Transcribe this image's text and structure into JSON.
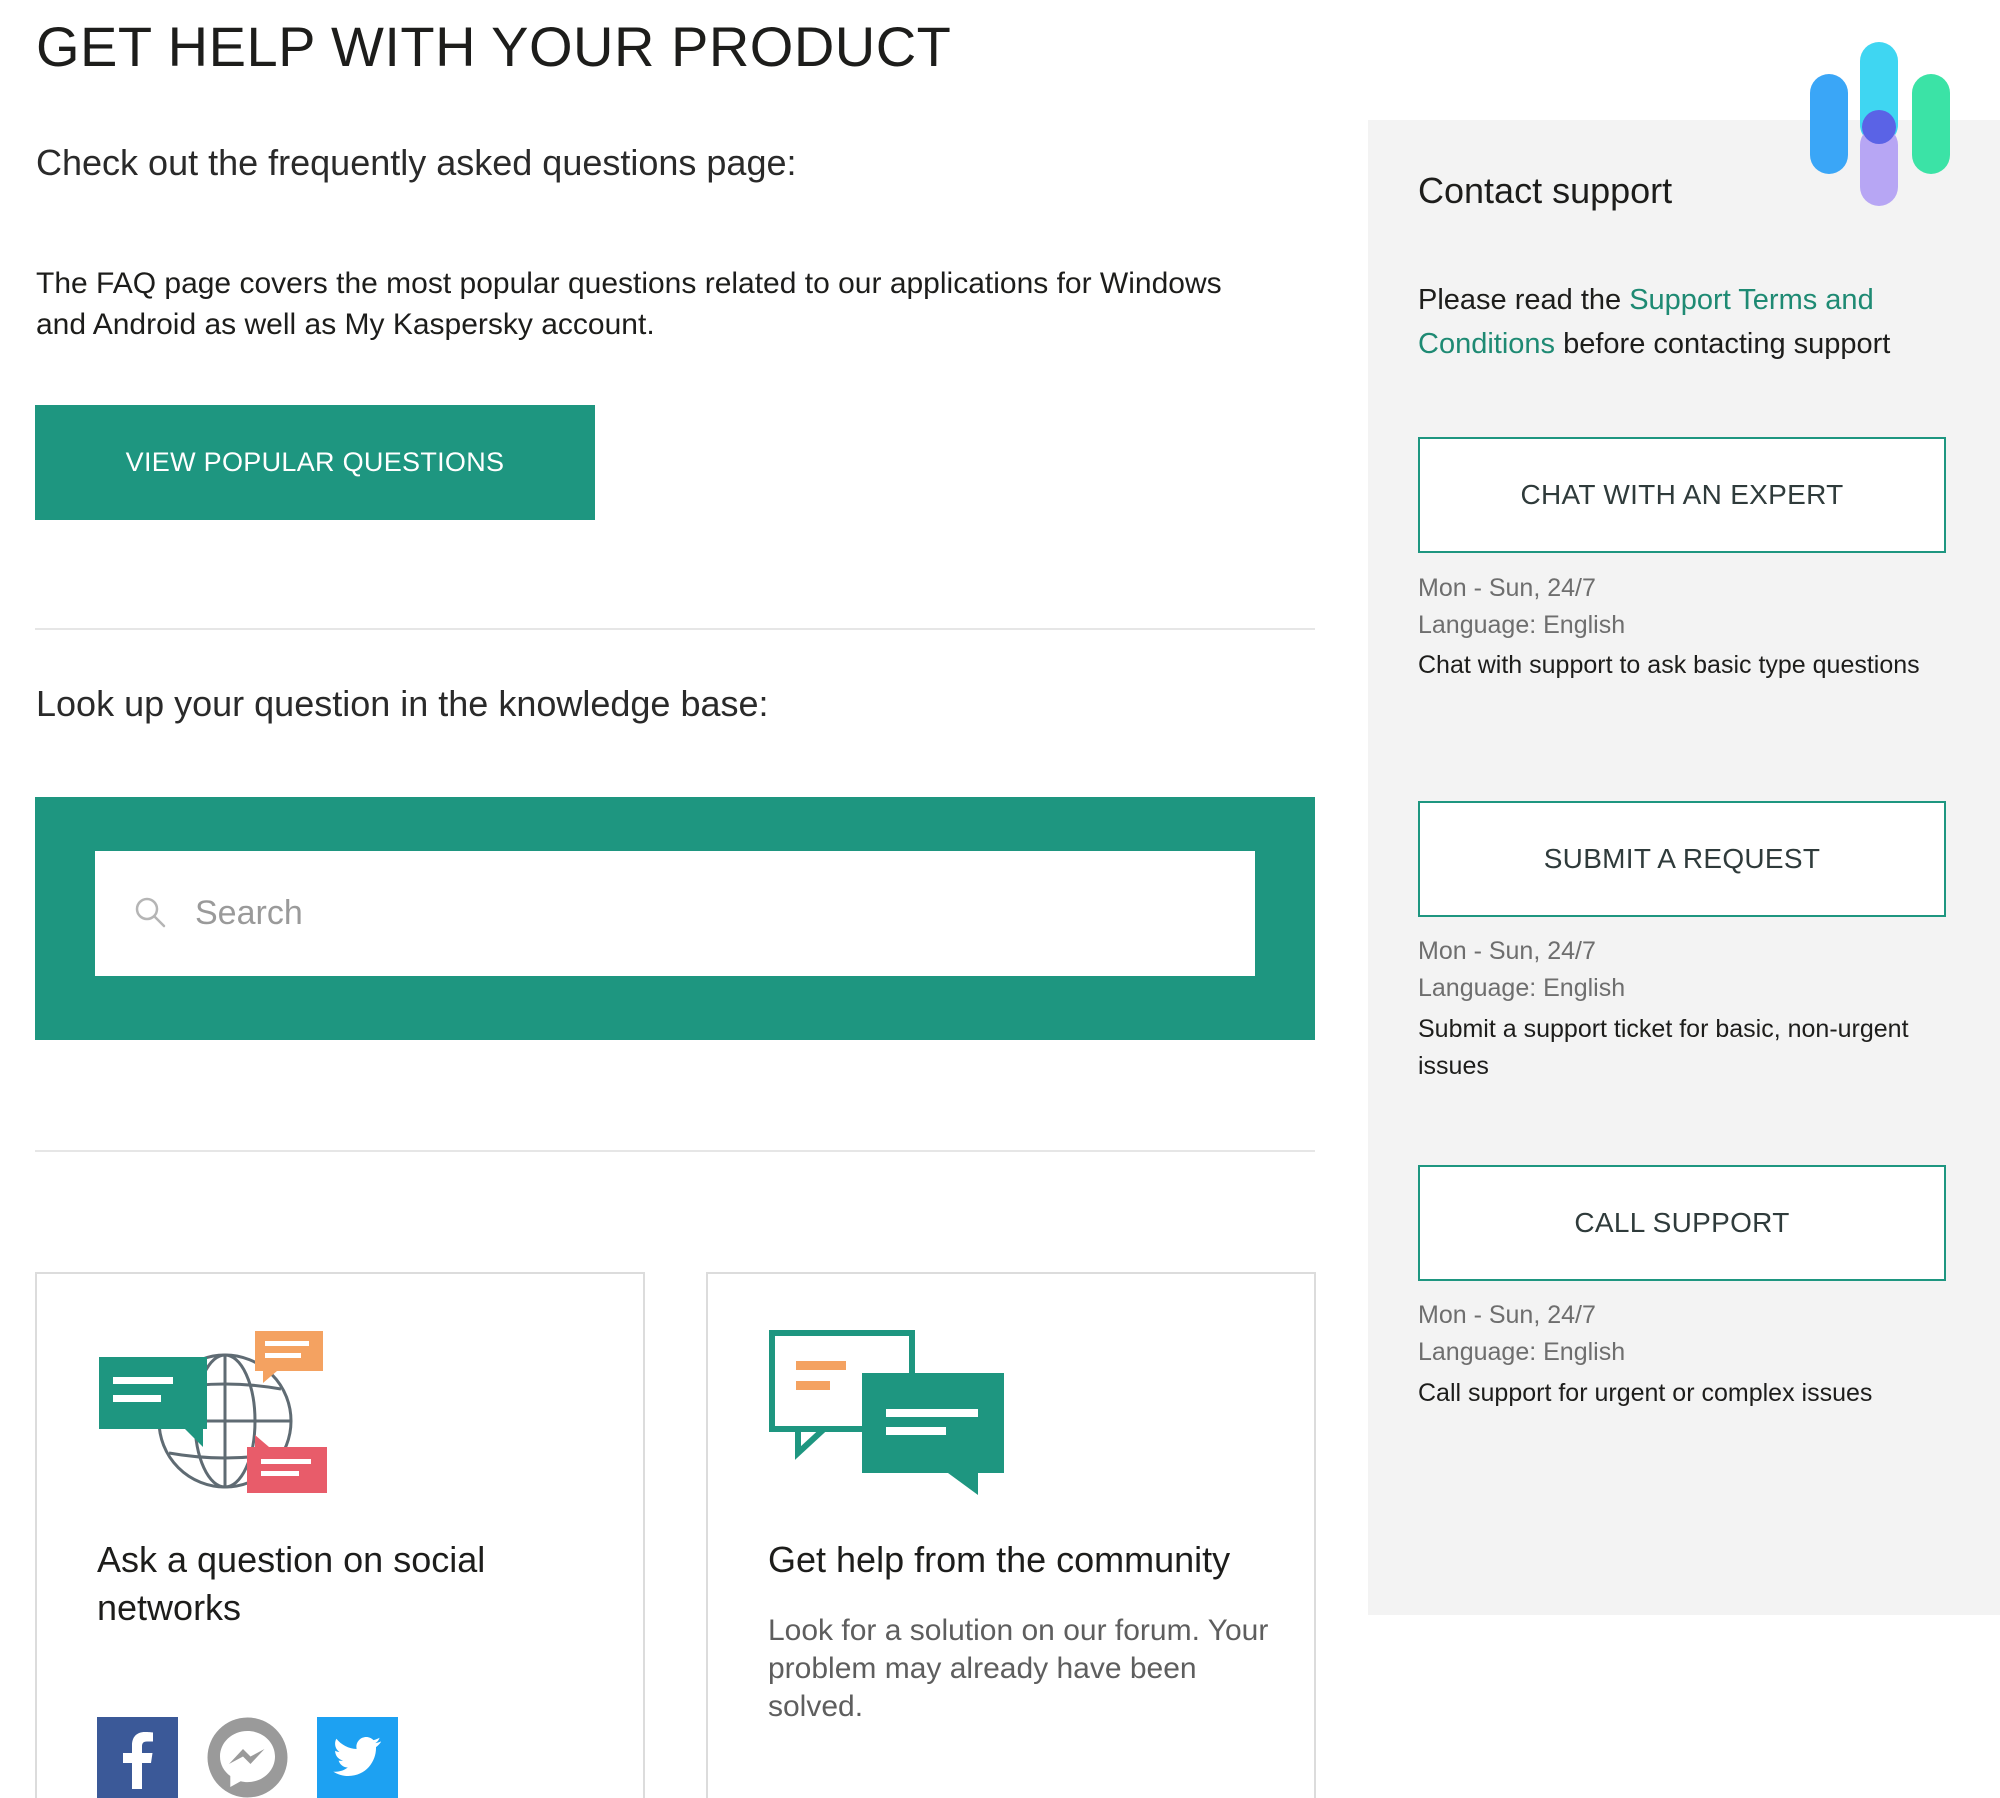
{
  "page": {
    "title": "GET HELP WITH YOUR PRODUCT"
  },
  "faq": {
    "heading": "Check out the frequently asked questions page:",
    "description": "The FAQ page covers the most popular questions related to our applications for Windows and Android as well as My Kaspersky account.",
    "button_label": "VIEW POPULAR QUESTIONS"
  },
  "knowledge_base": {
    "heading": "Look up your question in the knowledge base:",
    "search": {
      "placeholder": "Search",
      "value": ""
    }
  },
  "cards": {
    "social": {
      "title": "Ask a question on social networks",
      "icons": [
        "facebook-icon",
        "messenger-icon",
        "twitter-icon"
      ]
    },
    "community": {
      "title": "Get help from the community",
      "description": "Look for a solution on our forum. Your problem may already have been solved."
    }
  },
  "sidebar": {
    "title": "Contact support",
    "terms_prefix": "Please read the ",
    "terms_link": "Support Terms and Conditions",
    "terms_suffix": " before contacting support",
    "options": [
      {
        "button": "CHAT WITH AN EXPERT",
        "hours": "Mon - Sun, 24/7",
        "language": "Language: English",
        "description": "Chat with support to ask basic type questions"
      },
      {
        "button": "SUBMIT A REQUEST",
        "hours": "Mon - Sun, 24/7",
        "language": "Language: English",
        "description": "Submit a support ticket for basic, non-urgent issues"
      },
      {
        "button": "CALL SUPPORT",
        "hours": "Mon - Sun, 24/7",
        "language": "Language: English",
        "description": "Call support for urgent or complex issues"
      }
    ]
  },
  "colors": {
    "brand_green": "#1e9680",
    "link_green": "#1e8a73",
    "sidebar_bg": "#f3f3f3",
    "facebook_blue": "#3b5998",
    "twitter_blue": "#1da1f2",
    "messenger_gray": "#9a9a9a"
  }
}
